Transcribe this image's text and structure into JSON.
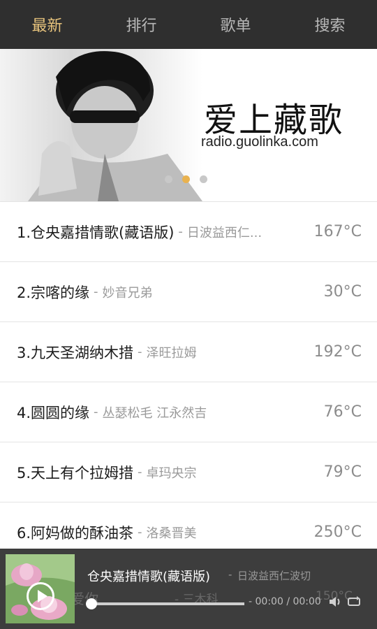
{
  "tabs": [
    {
      "label": "最新",
      "active": true
    },
    {
      "label": "排行",
      "active": false
    },
    {
      "label": "歌单",
      "active": false
    },
    {
      "label": "搜索",
      "active": false
    }
  ],
  "banner": {
    "title": "爱上藏歌",
    "url": "radio.guolinka.com",
    "dots": 3,
    "active_dot": 2
  },
  "songs": [
    {
      "title": "1.仓央嘉措情歌(藏语版)",
      "artist": "日波益西仁...",
      "temp": "167°C"
    },
    {
      "title": "2.宗喀的缘",
      "artist": "妙音兄弟",
      "temp": "30°C"
    },
    {
      "title": "3.九天圣湖纳木措",
      "artist": "泽旺拉姆",
      "temp": "192°C"
    },
    {
      "title": "4.圆圆的缘",
      "artist": "丛瑟松毛 江永然吉",
      "temp": "76°C"
    },
    {
      "title": "5.天上有个拉姆措",
      "artist": "卓玛央宗",
      "temp": "79°C"
    },
    {
      "title": "6.阿妈做的酥油茶",
      "artist": "洛桑晋美",
      "temp": "250°C"
    }
  ],
  "list_separator": "-",
  "player": {
    "title": "仓央嘉措情歌(藏语版)",
    "separator": "-",
    "artist": "日波益西仁波切",
    "ghost_title": "7.我爱你",
    "ghost_artist": "- 三木科",
    "ghost_temp": "150°C",
    "current_time": "- 00:00",
    "total_time": "00:00",
    "progress_fraction": 0
  },
  "colors": {
    "tab_bar": "#2f2f2f",
    "tab_active": "#e7c37c",
    "tab_inactive": "#b9b9b9",
    "dot_active": "#e9b24f",
    "player_bg": "#3d3d3d"
  }
}
